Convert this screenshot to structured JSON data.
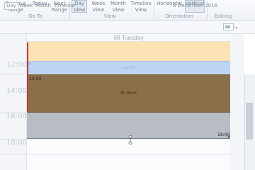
{
  "ribbon": {
    "goto": {
      "previous_range": "Previous\nRange",
      "today": "Today",
      "next_range": "Next\nRange",
      "group_label": "Go To"
    },
    "view": {
      "day_view": "Day\nView",
      "week_view": "Week\nView",
      "month_view": "Month\nView",
      "timeline_view": "Timeline\nView",
      "group_label": "View"
    },
    "orientation": {
      "horizontal": "Horizontal",
      "vertical": "Vertical",
      "group_label": "Orientation"
    },
    "editing": {
      "group_label": "Editing"
    }
  },
  "subbar": {
    "tabs": [
      "Day",
      "Week",
      "Month",
      "Timeline"
    ],
    "active_tab": "Day",
    "date": "8 December 2016"
  },
  "calendar": {
    "day_header": "08 Tuesday",
    "hours": [
      "12:00",
      "14:00",
      "16:00",
      "18:00"
    ],
    "events": {
      "lunch": "Lunch",
      "at_work": "At Work",
      "at_work_start": "13:00",
      "afternoon_end": "18:00"
    }
  },
  "colors": {
    "morning": "#fde2b5",
    "lunch": "#bcd5f5",
    "at_work": "#8a7049",
    "afternoon": "#b7bcc5"
  }
}
